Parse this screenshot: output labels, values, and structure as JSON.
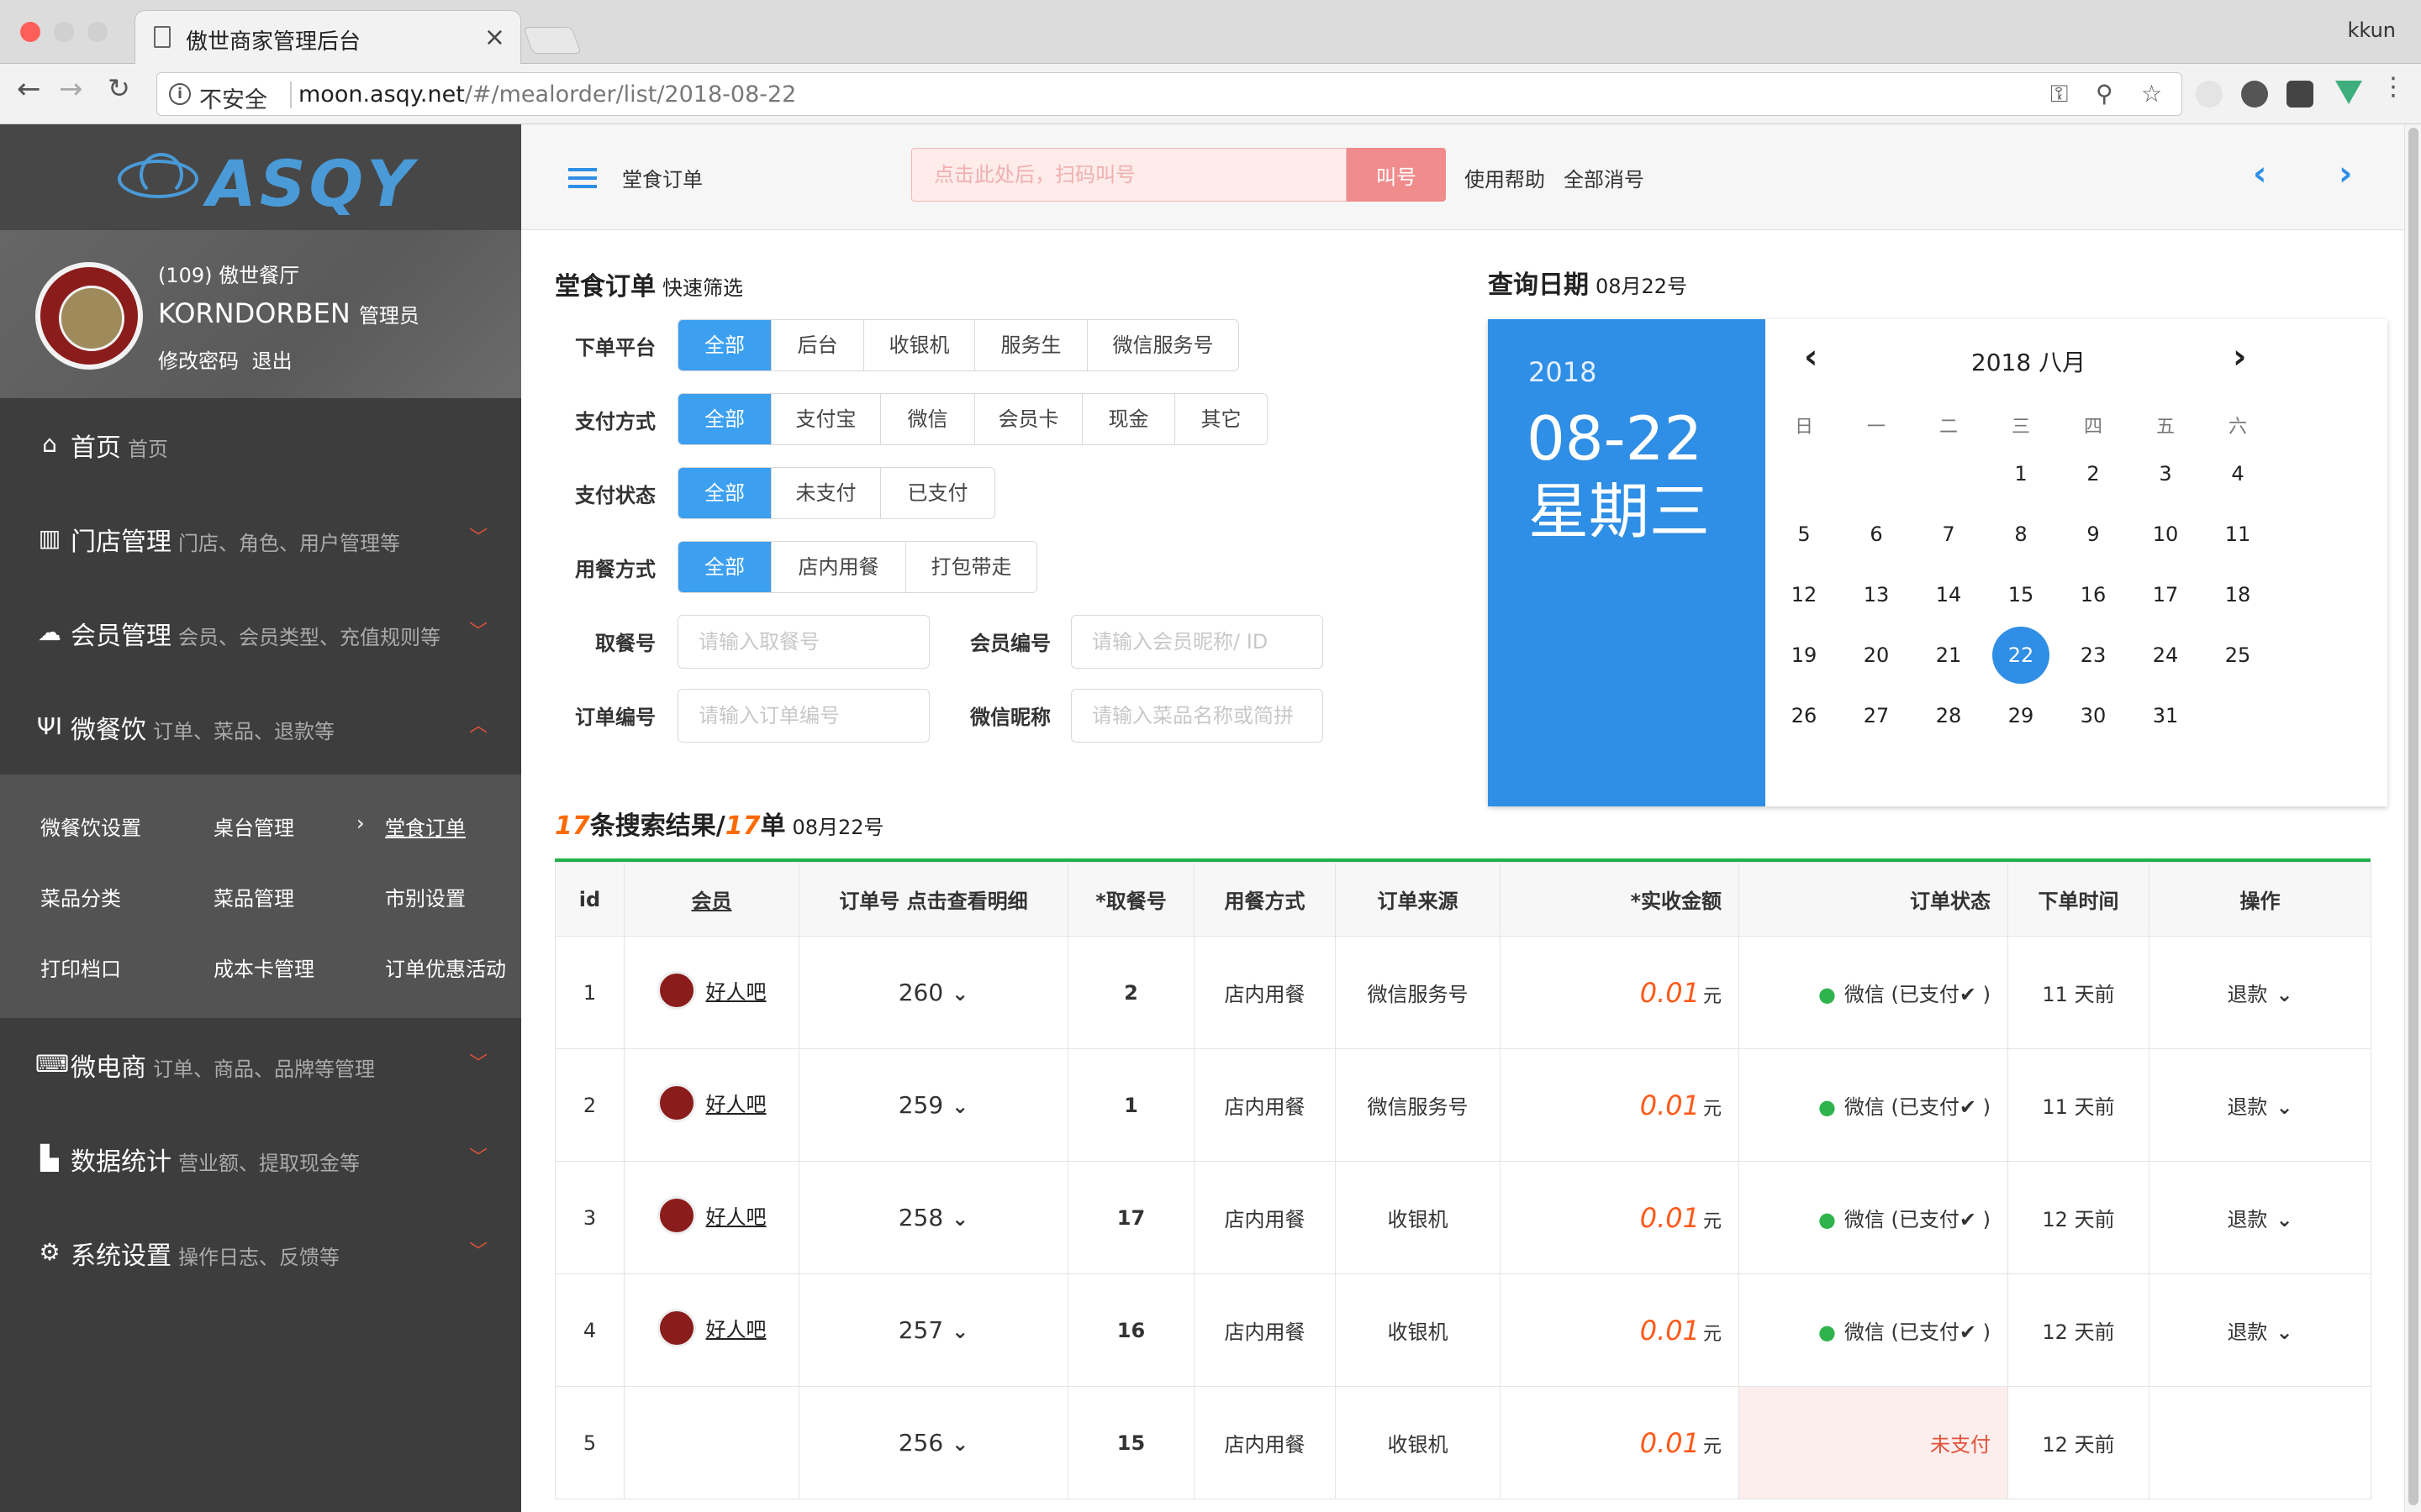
{
  "browser": {
    "tab_title": "傲世商家管理后台",
    "profile": "kkun",
    "security": "不安全",
    "url_host": "moon.asqy.net",
    "url_path": "/#/mealorder/list/2018-08-22"
  },
  "sidebar": {
    "logo": "ASQY",
    "shop": "(109) 傲世餐厅",
    "user_name": "KORNDORBEN",
    "user_role": "管理员",
    "change_pwd": "修改密码",
    "logout": "退出",
    "menu": [
      {
        "title": "首页",
        "desc": "首页"
      },
      {
        "title": "门店管理",
        "desc": "门店、角色、用户管理等"
      },
      {
        "title": "会员管理",
        "desc": "会员、会员类型、充值规则等"
      },
      {
        "title": "微餐饮",
        "desc": "订单、菜品、退款等"
      },
      {
        "title": "微电商",
        "desc": "订单、商品、品牌等管理"
      },
      {
        "title": "数据统计",
        "desc": "营业额、提取现金等"
      },
      {
        "title": "系统设置",
        "desc": "操作日志、反馈等"
      }
    ],
    "submenu": [
      "微餐饮设置",
      "桌台管理",
      "堂食订单",
      "菜品分类",
      "菜品管理",
      "市别设置",
      "打印档口",
      "成本卡管理",
      "订单优惠活动"
    ]
  },
  "header": {
    "title": "堂食订单",
    "call_placeholder": "点击此处后，扫码叫号",
    "call_button": "叫号",
    "help": "使用帮助",
    "clear_all": "全部消号"
  },
  "filters": {
    "title": "堂食订单",
    "subtitle": "快速筛选",
    "platform": {
      "label": "下单平台",
      "options": [
        "全部",
        "后台",
        "收银机",
        "服务生",
        "微信服务号"
      ]
    },
    "payment": {
      "label": "支付方式",
      "options": [
        "全部",
        "支付宝",
        "微信",
        "会员卡",
        "现金",
        "其它"
      ]
    },
    "pay_status": {
      "label": "支付状态",
      "options": [
        "全部",
        "未支付",
        "已支付"
      ]
    },
    "dining": {
      "label": "用餐方式",
      "options": [
        "全部",
        "店内用餐",
        "打包带走"
      ]
    },
    "pickup_label": "取餐号",
    "pickup_placeholder": "请输入取餐号",
    "member_label": "会员编号",
    "member_placeholder": "请输入会员昵称/ ID",
    "order_label": "订单编号",
    "order_placeholder": "请输入订单编号",
    "wechat_label": "微信昵称",
    "wechat_placeholder": "请输入菜品名称或简拼"
  },
  "calendar": {
    "title": "查询日期",
    "title_date": "08月22号",
    "year": "2018",
    "date": "08-22",
    "weekday": "星期三",
    "month_label": "2018 八月",
    "weekdays": [
      "日",
      "一",
      "二",
      "三",
      "四",
      "五",
      "六"
    ],
    "first_weekday": 3,
    "days_in_month": 31,
    "selected_day": 22
  },
  "results": {
    "count": "17",
    "count_text": "条搜索结果/",
    "orders": "17",
    "orders_text": "单",
    "date": "08月22号"
  },
  "table": {
    "headers": [
      "id",
      "会员",
      "订单号 点击查看明细",
      "*取餐号",
      "用餐方式",
      "订单来源",
      "*实收金额",
      "订单状态",
      "下单时间",
      "操作"
    ],
    "rows": [
      {
        "id": "1",
        "member": "好人吧",
        "order": "260",
        "pickup": "2",
        "dining": "店内用餐",
        "source": "微信服务号",
        "amount": "0.01",
        "unit": "元",
        "status": "微信 (已支付✔ )",
        "paid": true,
        "time": "11 天前",
        "action": "退款"
      },
      {
        "id": "2",
        "member": "好人吧",
        "order": "259",
        "pickup": "1",
        "dining": "店内用餐",
        "source": "微信服务号",
        "amount": "0.01",
        "unit": "元",
        "status": "微信 (已支付✔ )",
        "paid": true,
        "time": "11 天前",
        "action": "退款"
      },
      {
        "id": "3",
        "member": "好人吧",
        "order": "258",
        "pickup": "17",
        "dining": "店内用餐",
        "source": "收银机",
        "amount": "0.01",
        "unit": "元",
        "status": "微信 (已支付✔ )",
        "paid": true,
        "time": "12 天前",
        "action": "退款"
      },
      {
        "id": "4",
        "member": "好人吧",
        "order": "257",
        "pickup": "16",
        "dining": "店内用餐",
        "source": "收银机",
        "amount": "0.01",
        "unit": "元",
        "status": "微信 (已支付✔ )",
        "paid": true,
        "time": "12 天前",
        "action": "退款"
      },
      {
        "id": "5",
        "member": "",
        "order": "256",
        "pickup": "15",
        "dining": "店内用餐",
        "source": "收银机",
        "amount": "0.01",
        "unit": "元",
        "status": "未支付",
        "paid": false,
        "time": "12 天前",
        "action": ""
      }
    ]
  },
  "colors": {
    "accent": "#2f8ee5",
    "success": "#22b04b",
    "amount": "#ff5a1a",
    "danger": "#e0533a"
  }
}
